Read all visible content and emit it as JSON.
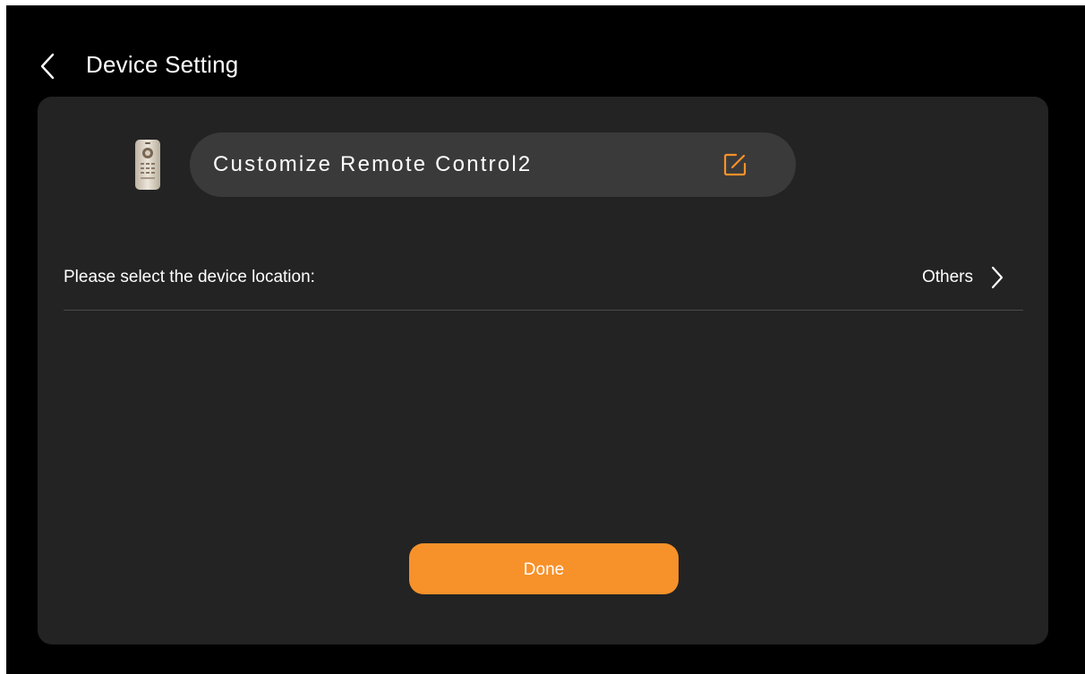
{
  "header": {
    "title": "Device Setting",
    "back_icon": "chevron-left-icon"
  },
  "device": {
    "icon": "remote-control-icon",
    "name": "Customize Remote Control2",
    "edit_icon": "edit-icon"
  },
  "location": {
    "label": "Please select the device location:",
    "value": "Others",
    "chevron_icon": "chevron-right-icon"
  },
  "actions": {
    "done_label": "Done"
  },
  "colors": {
    "background": "#000000",
    "card": "#232323",
    "pill": "#3a3a3a",
    "accent": "#f7912a",
    "divider": "#4a4a4a",
    "text": "#ffffff"
  }
}
